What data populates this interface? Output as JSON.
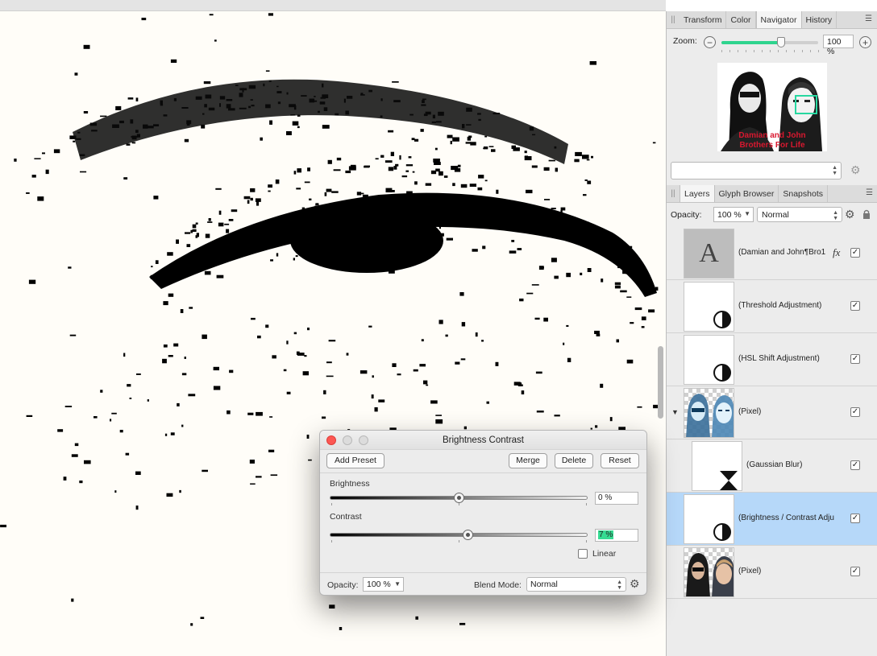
{
  "navigator_panel": {
    "tabs": [
      {
        "label": "Transform",
        "active": false
      },
      {
        "label": "Color",
        "active": false
      },
      {
        "label": "Navigator",
        "active": true
      },
      {
        "label": "History",
        "active": false
      }
    ],
    "zoom_label": "Zoom:",
    "zoom_value": "100 %",
    "zoom_level_fraction": 0.62,
    "preview_caption": [
      "Damian and John",
      "Brothers For Life"
    ]
  },
  "layers_panel": {
    "tabs": [
      {
        "label": "Layers",
        "active": true
      },
      {
        "label": "Glyph Browser",
        "active": false
      },
      {
        "label": "Snapshots",
        "active": false
      }
    ],
    "opacity_label": "Opacity:",
    "opacity_value": "100 %",
    "blend_mode": "Normal",
    "layers": [
      {
        "name": "(Damian and John¶Bro1",
        "kind": "text",
        "thumb_letter": "A",
        "fx": "fx",
        "visible": true,
        "selected": false,
        "child": false
      },
      {
        "name": "(Threshold Adjustment)",
        "kind": "adjustment",
        "visible": true,
        "selected": false,
        "child": false
      },
      {
        "name": "(HSL Shift Adjustment)",
        "kind": "adjustment",
        "visible": true,
        "selected": false,
        "child": false
      },
      {
        "name": "(Pixel)",
        "kind": "pixel-blue",
        "visible": true,
        "selected": false,
        "child": false,
        "expanded": true
      },
      {
        "name": "(Gaussian Blur)",
        "kind": "filter",
        "visible": true,
        "selected": false,
        "child": true
      },
      {
        "name": "(Brightness / Contrast Adju",
        "kind": "adjustment",
        "visible": true,
        "selected": true,
        "child": false
      },
      {
        "name": "(Pixel)",
        "kind": "pixel-photo",
        "visible": true,
        "selected": false,
        "child": false
      }
    ]
  },
  "dialog": {
    "title": "Brightness Contrast",
    "add_preset": "Add Preset",
    "merge": "Merge",
    "delete": "Delete",
    "reset": "Reset",
    "brightness_label": "Brightness",
    "brightness_value": "0 %",
    "brightness_level": 0.5,
    "contrast_label": "Contrast",
    "contrast_value": "7 %",
    "contrast_level": 0.535,
    "linear_label": "Linear",
    "linear_checked": false,
    "opacity_label": "Opacity:",
    "opacity_value": "100 %",
    "blend_label": "Blend Mode:",
    "blend_value": "Normal"
  },
  "colors": {
    "accent_green": "#2fd48e",
    "selection_blue": "#b6d8f9",
    "close_red": "#fc5753",
    "caption_red": "#d8182f"
  }
}
